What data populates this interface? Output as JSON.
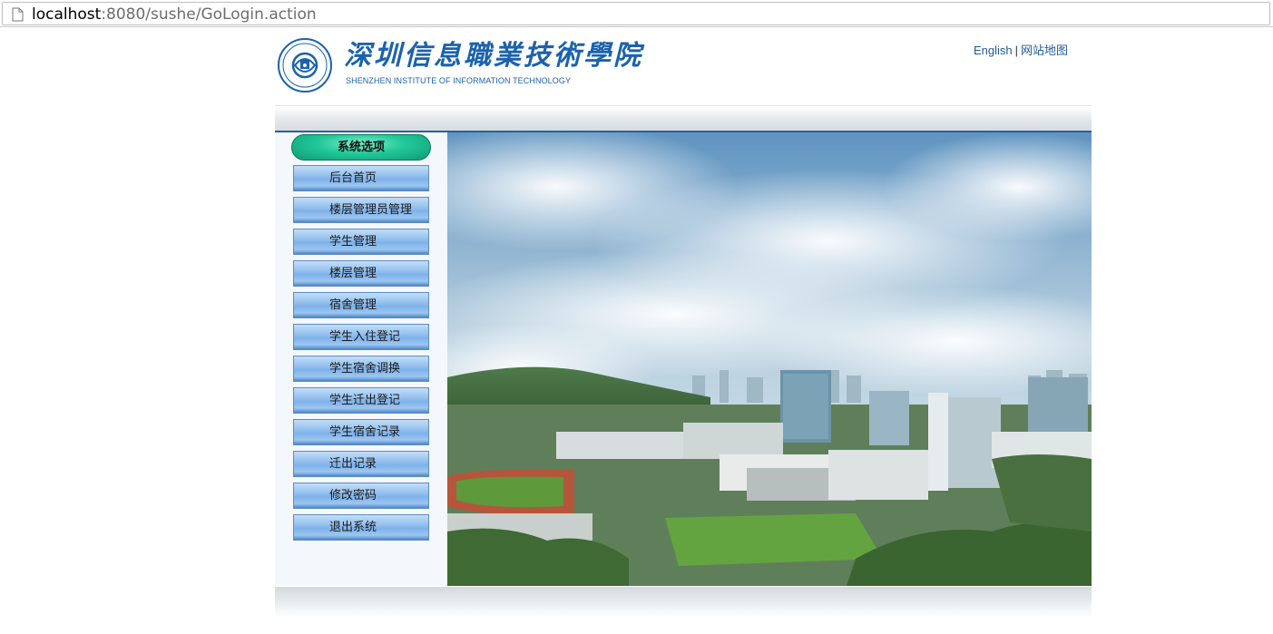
{
  "browser": {
    "url_host": "localhost",
    "url_rest": ":8080/sushe/GoLogin.action"
  },
  "header": {
    "logo_cn": "深圳信息職業技術學院",
    "logo_en": "SHENZHEN INSTITUTE OF INFORMATION TECHNOLOGY",
    "links": {
      "english": "English",
      "separator": "|",
      "sitemap": "网站地图"
    }
  },
  "sidebar": {
    "title": "系统选项",
    "items": [
      {
        "label": "后台首页"
      },
      {
        "label": "楼层管理员管理"
      },
      {
        "label": "学生管理"
      },
      {
        "label": "楼层管理"
      },
      {
        "label": "宿舍管理"
      },
      {
        "label": "学生入住登记"
      },
      {
        "label": "学生宿舍调换"
      },
      {
        "label": "学生迁出登记"
      },
      {
        "label": "学生宿舍记录"
      },
      {
        "label": "迁出记录"
      },
      {
        "label": "修改密码"
      },
      {
        "label": "退出系统"
      }
    ]
  },
  "colors": {
    "brand_blue": "#1b62ad",
    "title_green": "#22c79a",
    "menu_blue": "#7fb2ea",
    "divider": "#2b5f9c"
  },
  "icons": [
    "page-icon",
    "school-seal-icon"
  ]
}
